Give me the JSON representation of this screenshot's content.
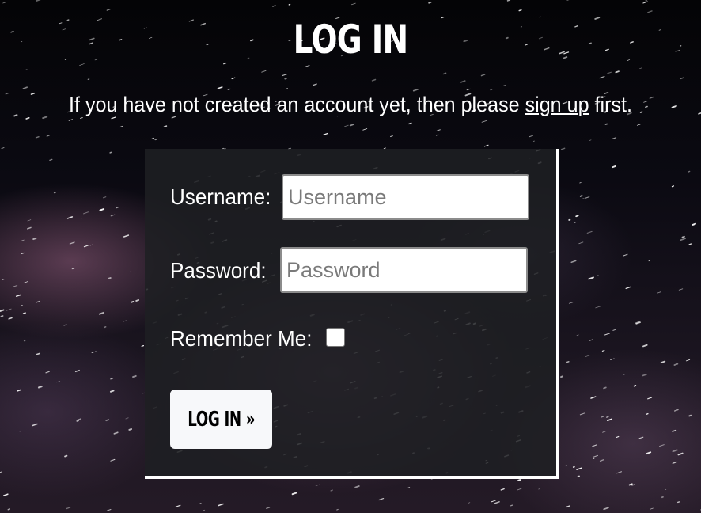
{
  "page": {
    "title": "LOG IN",
    "intro_before": "If you have not created an account yet, then please ",
    "intro_link": "sign up",
    "intro_after": " first."
  },
  "form": {
    "username_label": "Username:",
    "username_placeholder": "Username",
    "username_value": "",
    "password_label": "Password:",
    "password_placeholder": "Password",
    "password_value": "",
    "remember_label": "Remember Me:",
    "remember_checked": false,
    "submit_label": "LOG IN »"
  },
  "colors": {
    "background": "#07070b",
    "card": "#1e2023",
    "text": "#ffffff",
    "button": "#f7f8fa"
  }
}
